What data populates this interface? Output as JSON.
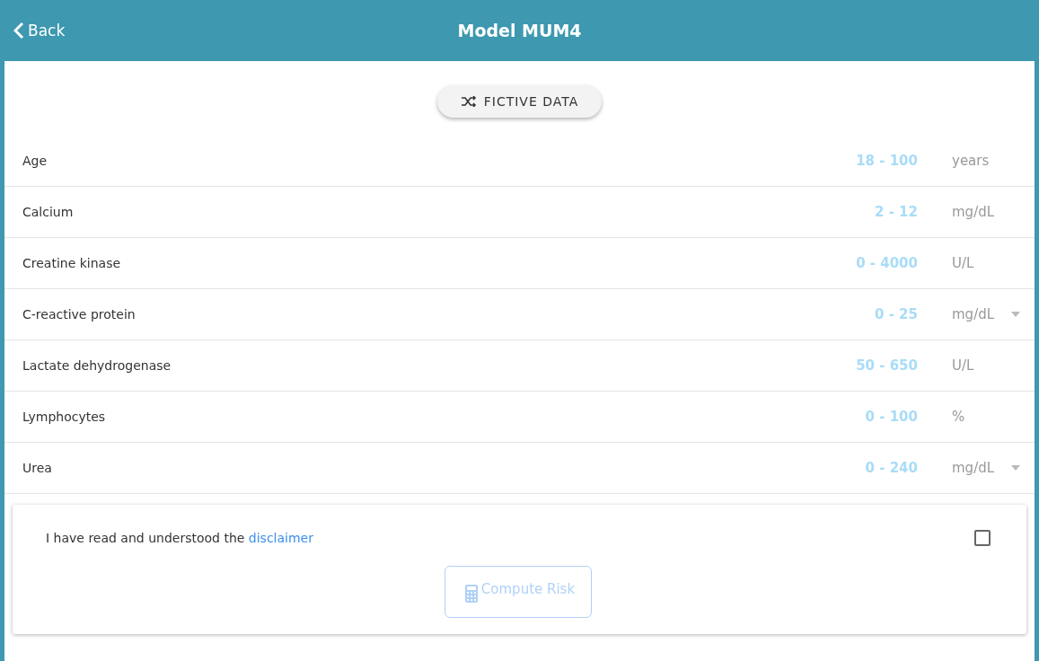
{
  "header": {
    "back": "Back",
    "title": "Model MUM4"
  },
  "fictive_button": {
    "label": "FICTIVE DATA"
  },
  "fields": [
    {
      "label": "Age",
      "placeholder": "18 - 100",
      "unit": "years",
      "kind": "fixed"
    },
    {
      "label": "Calcium",
      "placeholder": "2 - 12",
      "unit": "mg/dL",
      "kind": "fixed"
    },
    {
      "label": "Creatine kinase",
      "placeholder": "0 - 4000",
      "unit": "U/L",
      "kind": "fixed"
    },
    {
      "label": "C-reactive protein",
      "placeholder": "0 - 25",
      "unit": "mg/dL",
      "kind": "select"
    },
    {
      "label": "Lactate dehydrogenase",
      "placeholder": "50 - 650",
      "unit": "U/L",
      "kind": "fixed"
    },
    {
      "label": "Lymphocytes",
      "placeholder": "0 - 100",
      "unit": "%",
      "kind": "fixed"
    },
    {
      "label": "Urea",
      "placeholder": "0 - 240",
      "unit": "mg/dL",
      "kind": "select"
    }
  ],
  "disclaimer": {
    "text": "I have read and understood the",
    "link": "disclaimer",
    "checked": false
  },
  "compute_button": {
    "label": "Compute Risk",
    "disabled": true
  }
}
